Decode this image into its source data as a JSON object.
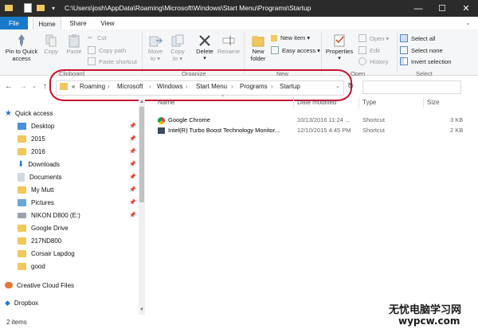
{
  "window": {
    "title_path": "C:\\Users\\josh\\AppData\\Roaming\\Microsoft\\Windows\\Start Menu\\Programs\\Startup"
  },
  "tabs": [
    "File",
    "Home",
    "Share",
    "View"
  ],
  "ribbon": {
    "clipboard": {
      "pin_label_1": "Pin to Quick",
      "pin_label_2": "access",
      "copy": "Copy",
      "paste": "Paste",
      "cut": "Cut",
      "copy_path": "Copy path",
      "paste_shortcut": "Paste shortcut",
      "group": "Clipboard"
    },
    "organize": {
      "move_to_1": "Move",
      "move_to_2": "to ▾",
      "copy_to_1": "Copy",
      "copy_to_2": "to ▾",
      "delete": "Delete",
      "rename": "Rename",
      "group": "Organize"
    },
    "new": {
      "new_folder_1": "New",
      "new_folder_2": "folder",
      "new_item": "New item ▾",
      "easy_access": "Easy access ▾",
      "group": "New"
    },
    "open": {
      "properties": "Properties",
      "open": "Open ▾",
      "edit": "Edit",
      "history": "History",
      "group": "Open"
    },
    "select": {
      "select_all": "Select all",
      "select_none": "Select none",
      "invert_selection": "Invert selection",
      "group": "Select"
    }
  },
  "breadcrumb": [
    "«",
    "Roaming",
    "Microsoft",
    "Windows",
    "Start Menu",
    "Programs",
    "Startup"
  ],
  "nav_pane": {
    "quick_access": "Quick access",
    "items": [
      "Desktop",
      "2015",
      "2016",
      "Downloads",
      "Documents",
      "My Mutt",
      "Pictures",
      "NIKON D800 (E:)",
      "Google Drive",
      "217ND800",
      "Corsair Lapdog",
      "good"
    ],
    "creative_cloud": "Creative Cloud Files",
    "dropbox": "Dropbox"
  },
  "columns": {
    "name": "Name",
    "date": "Date modified",
    "type": "Type",
    "size": "Size"
  },
  "files": [
    {
      "name": "Google Chrome",
      "date": "10/13/2016 11:24 ...",
      "type": "Shortcut",
      "size": "3 KB"
    },
    {
      "name": "Intel(R) Turbo Boost Technology Monitor...",
      "date": "12/10/2015 4:45 PM",
      "type": "Shortcut",
      "size": "2 KB"
    }
  ],
  "status": {
    "items": "2 items"
  },
  "watermark": {
    "line1": "无忧电脑学习网",
    "line2": "wypcw.com"
  },
  "colors": {
    "titlebar": "#2b2b2b",
    "file_tab": "#1979ca",
    "annotation": "#c8102e",
    "folder": "#f2c75c"
  }
}
